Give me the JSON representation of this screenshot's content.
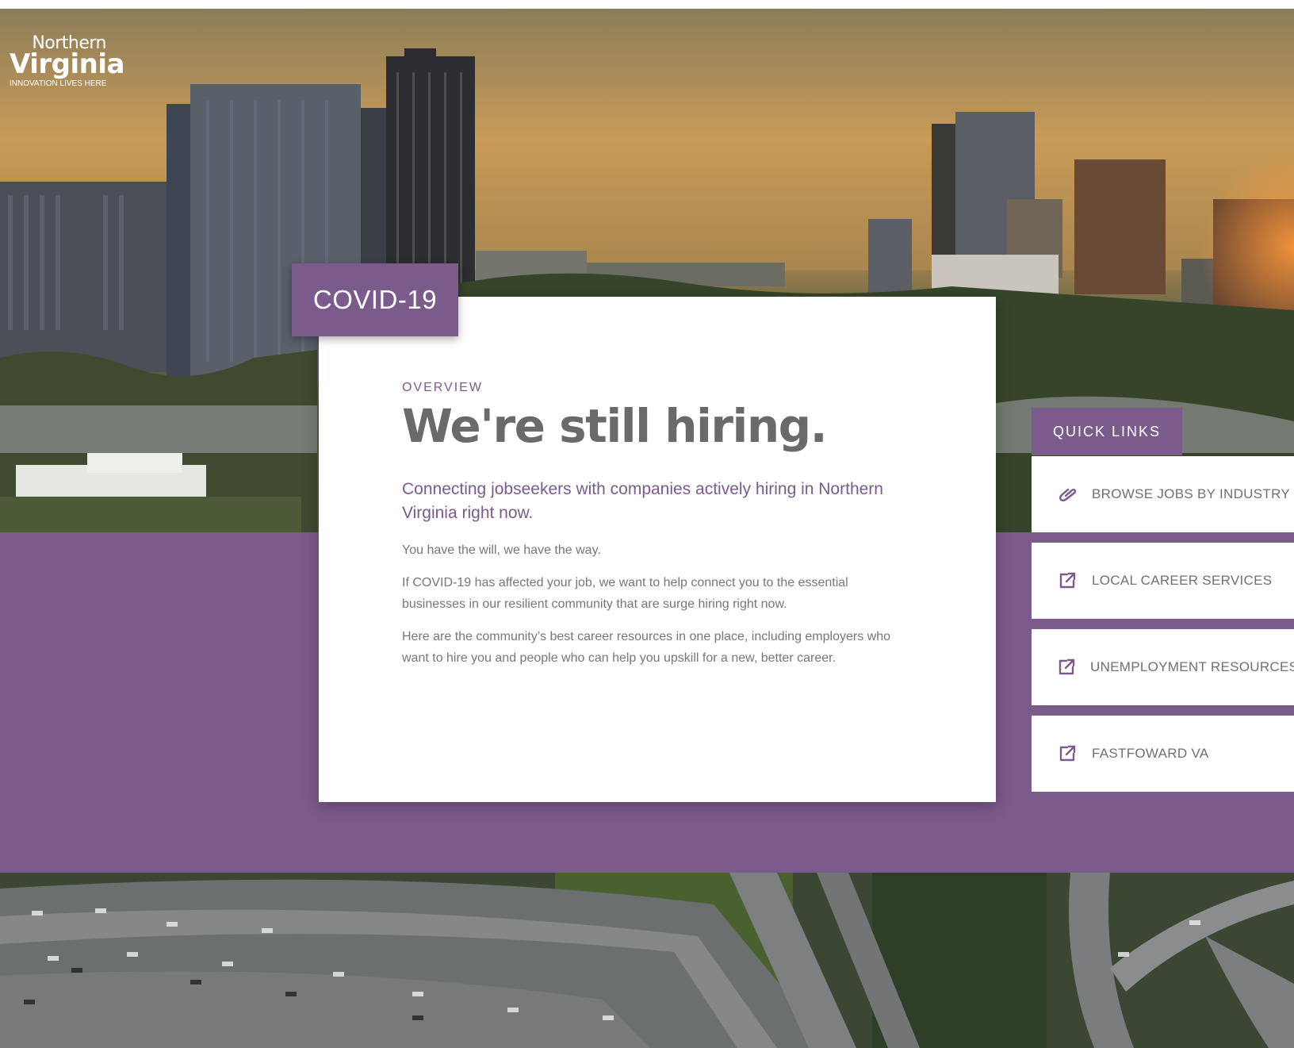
{
  "logo": {
    "line1": "Northern",
    "line2": "Virginia",
    "tagline": "INNOVATION LIVES HERE"
  },
  "card": {
    "tab_label": "COVID-19",
    "eyebrow": "OVERVIEW",
    "headline": "We're still hiring.",
    "subhead": "Connecting jobseekers with companies actively hiring in Northern Virginia right now.",
    "paragraphs": [
      "You have the will, we have the way.",
      "If COVID-19 has affected your job, we want to help connect you to the essential businesses in our resilient community that are surge hiring right now.",
      "Here are the community’s best career resources in one place, including employers who want to hire you and people who can help you upskill for a new, better career."
    ]
  },
  "quick_links": {
    "title": "QUICK LINKS",
    "items": [
      {
        "label": "BROWSE JOBS BY INDUSTRY",
        "icon": "link-icon"
      },
      {
        "label": "LOCAL CAREER SERVICES",
        "icon": "external-link-icon"
      },
      {
        "label": "UNEMPLOYMENT RESOURCES",
        "icon": "external-link-icon"
      },
      {
        "label": "FASTFOWARD VA",
        "icon": "external-link-icon"
      }
    ]
  },
  "colors": {
    "brand_purple": "#7b5a8c",
    "headline_gray": "#6a6a6a",
    "body_gray": "#777777"
  }
}
